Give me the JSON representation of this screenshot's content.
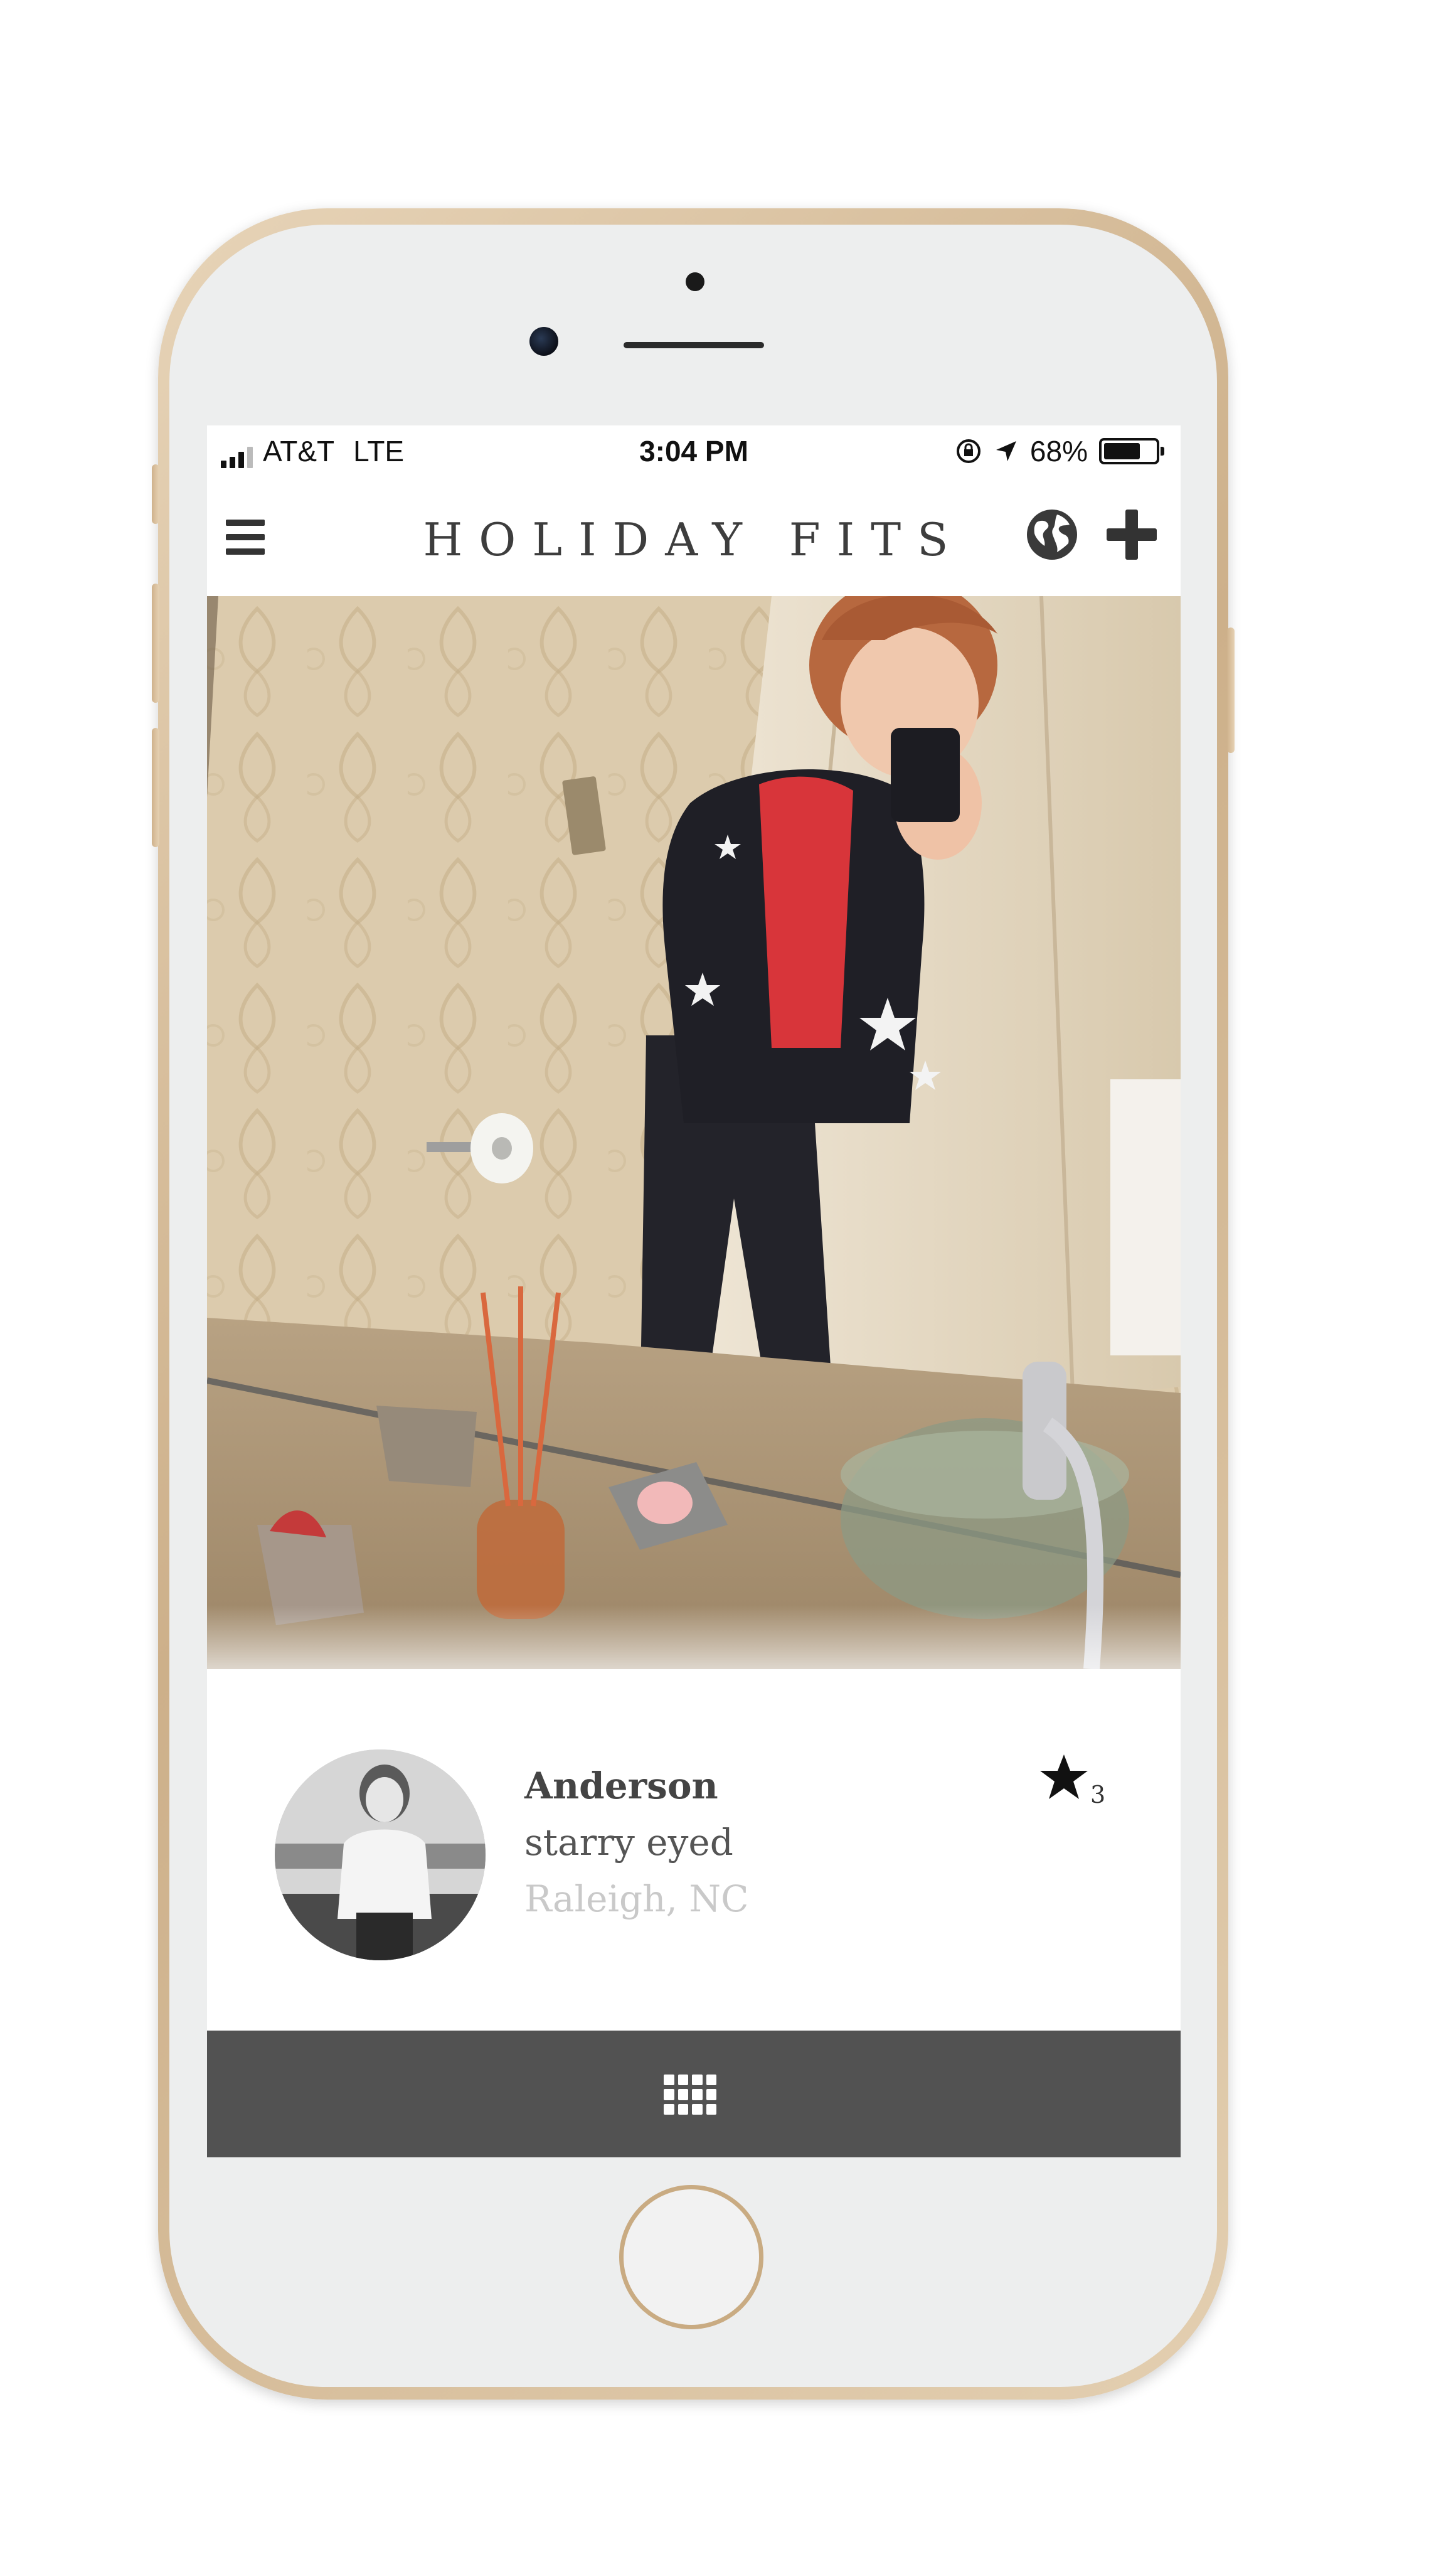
{
  "status_bar": {
    "carrier": "AT&T",
    "network": "LTE",
    "time": "3:04 PM",
    "battery_percent": "68%",
    "battery_level": 0.68
  },
  "header": {
    "title": "HOLIDAY FITS",
    "menu_icon": "hamburger-menu-icon",
    "globe_icon": "globe-icon",
    "add_icon": "plus-icon"
  },
  "post": {
    "username": "Anderson",
    "caption": "starry eyed",
    "location": "Raleigh, NC",
    "star_count": "3",
    "star_icon": "star-icon"
  },
  "bottom_bar": {
    "grid_icon": "grid-icon",
    "background": "#525252"
  },
  "colors": {
    "phone_frame": "#d9c19d",
    "title_text": "#3d3d3d",
    "location_text": "#c9c9c9"
  }
}
